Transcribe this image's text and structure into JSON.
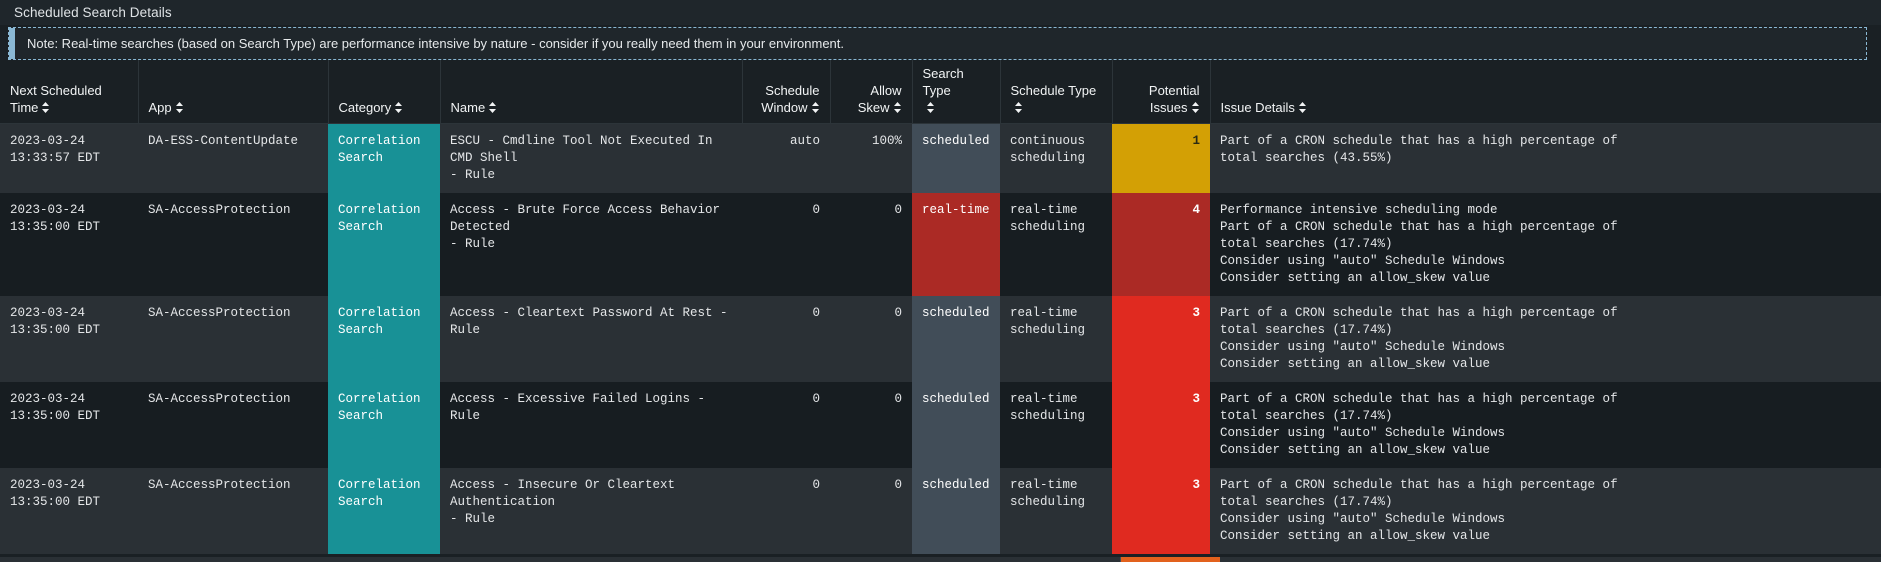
{
  "panel": {
    "title": "Scheduled Search Details"
  },
  "note": {
    "text": "Note: Real-time searches (based on Search Type) are performance intensive by nature - consider if you really need them in your environment.",
    "accent_color": "#8ab8d4"
  },
  "table": {
    "columns": [
      {
        "label": "Next Scheduled Time",
        "align": "left",
        "sortable": true
      },
      {
        "label": "App",
        "align": "left",
        "sortable": true
      },
      {
        "label": "Category",
        "align": "left",
        "sortable": true
      },
      {
        "label": "Name",
        "align": "left",
        "sortable": true
      },
      {
        "label": "Schedule Window",
        "align": "right",
        "sortable": true
      },
      {
        "label": "Allow Skew",
        "align": "right",
        "sortable": true
      },
      {
        "label": "Search Type",
        "align": "left",
        "sortable": true
      },
      {
        "label": "Schedule Type",
        "align": "left",
        "sortable": true
      },
      {
        "label": "Potential Issues",
        "align": "right",
        "sortable": true
      },
      {
        "label": "Issue Details",
        "align": "left",
        "sortable": true
      }
    ],
    "rows": [
      {
        "next_scheduled_time": "2023-03-24\n13:33:57 EDT",
        "app": "DA-ESS-ContentUpdate",
        "category": "Correlation\nSearch",
        "name": "ESCU - Cmdline Tool Not Executed In CMD Shell\n- Rule",
        "schedule_window": "auto",
        "allow_skew": "100%",
        "search_type": "scheduled",
        "schedule_type": "continuous\nscheduling",
        "potential_issues": "1",
        "issue_details": "Part of a CRON schedule that has a high percentage of\ntotal searches (43.55%)",
        "issue_color": "#d3a005"
      },
      {
        "next_scheduled_time": "2023-03-24\n13:35:00 EDT",
        "app": "SA-AccessProtection",
        "category": "Correlation\nSearch",
        "name": "Access - Brute Force Access Behavior Detected\n- Rule",
        "schedule_window": "0",
        "allow_skew": "0",
        "search_type": "real-time",
        "schedule_type": "real-time\nscheduling",
        "potential_issues": "4",
        "issue_details": "Performance intensive scheduling mode\nPart of a CRON schedule that has a high percentage of\ntotal searches (17.74%)\nConsider using \"auto\" Schedule Windows\nConsider setting an allow_skew value",
        "issue_color": "#ab2a25"
      },
      {
        "next_scheduled_time": "2023-03-24\n13:35:00 EDT",
        "app": "SA-AccessProtection",
        "category": "Correlation\nSearch",
        "name": "Access - Cleartext Password At Rest - Rule",
        "schedule_window": "0",
        "allow_skew": "0",
        "search_type": "scheduled",
        "schedule_type": "real-time\nscheduling",
        "potential_issues": "3",
        "issue_details": "Part of a CRON schedule that has a high percentage of\ntotal searches (17.74%)\nConsider using \"auto\" Schedule Windows\nConsider setting an allow_skew value",
        "issue_color": "#e02a20"
      },
      {
        "next_scheduled_time": "2023-03-24\n13:35:00 EDT",
        "app": "SA-AccessProtection",
        "category": "Correlation\nSearch",
        "name": "Access - Excessive Failed Logins - Rule",
        "schedule_window": "0",
        "allow_skew": "0",
        "search_type": "scheduled",
        "schedule_type": "real-time\nscheduling",
        "potential_issues": "3",
        "issue_details": "Part of a CRON schedule that has a high percentage of\ntotal searches (17.74%)\nConsider using \"auto\" Schedule Windows\nConsider setting an allow_skew value",
        "issue_color": "#e02a20"
      },
      {
        "next_scheduled_time": "2023-03-24\n13:35:00 EDT",
        "app": "SA-AccessProtection",
        "category": "Correlation\nSearch",
        "name": "Access - Insecure Or Cleartext Authentication\n- Rule",
        "schedule_window": "0",
        "allow_skew": "0",
        "search_type": "scheduled",
        "schedule_type": "real-time\nscheduling",
        "potential_issues": "3",
        "issue_details": "Part of a CRON schedule that has a high percentage of\ntotal searches (17.74%)\nConsider using \"auto\" Schedule Windows\nConsider setting an allow_skew value",
        "issue_color": "#e02a20"
      }
    ]
  },
  "colors": {
    "panel_bg": "#1a2024",
    "row_odd": "#2a3035",
    "row_even": "#171d21",
    "category_teal": "#189196",
    "search_type_scheduled": "#414d58",
    "search_type_realtime": "#ab2a25",
    "issue_yellow": "#d3a005",
    "issue_dark_red": "#ab2a25",
    "issue_red": "#e02a20"
  }
}
